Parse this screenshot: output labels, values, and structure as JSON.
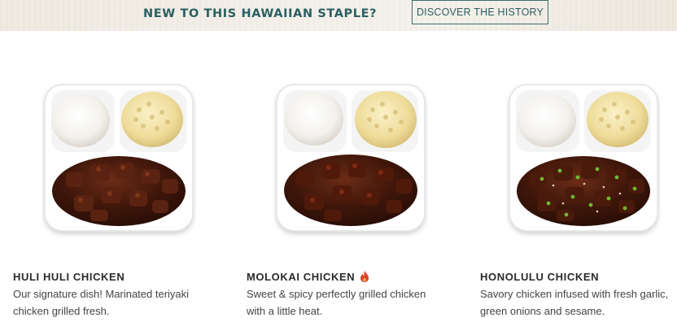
{
  "banner": {
    "heading": "NEW TO THIS HAWAIIAN STAPLE?",
    "button_label": "DISCOVER THE HISTORY"
  },
  "menu_items": [
    {
      "title": "HULI HULI CHICKEN",
      "description": "Our signature dish! Marinated teriyaki chicken grilled fresh.",
      "image": "plate-lunch-photo",
      "spicy": false
    },
    {
      "title": "MOLOKAI CHICKEN",
      "description": "Sweet & spicy perfectly grilled chicken with a little heat.",
      "image": "plate-lunch-photo",
      "spicy": true,
      "badge_icon": "flame-icon"
    },
    {
      "title": "HONOLULU CHICKEN",
      "description": "Savory chicken infused with fresh garlic, green onions and sesame.",
      "image": "plate-lunch-photo",
      "spicy": false
    }
  ],
  "colors": {
    "accent_teal": "#2b5f61",
    "spicy_red": "#d9432b"
  }
}
